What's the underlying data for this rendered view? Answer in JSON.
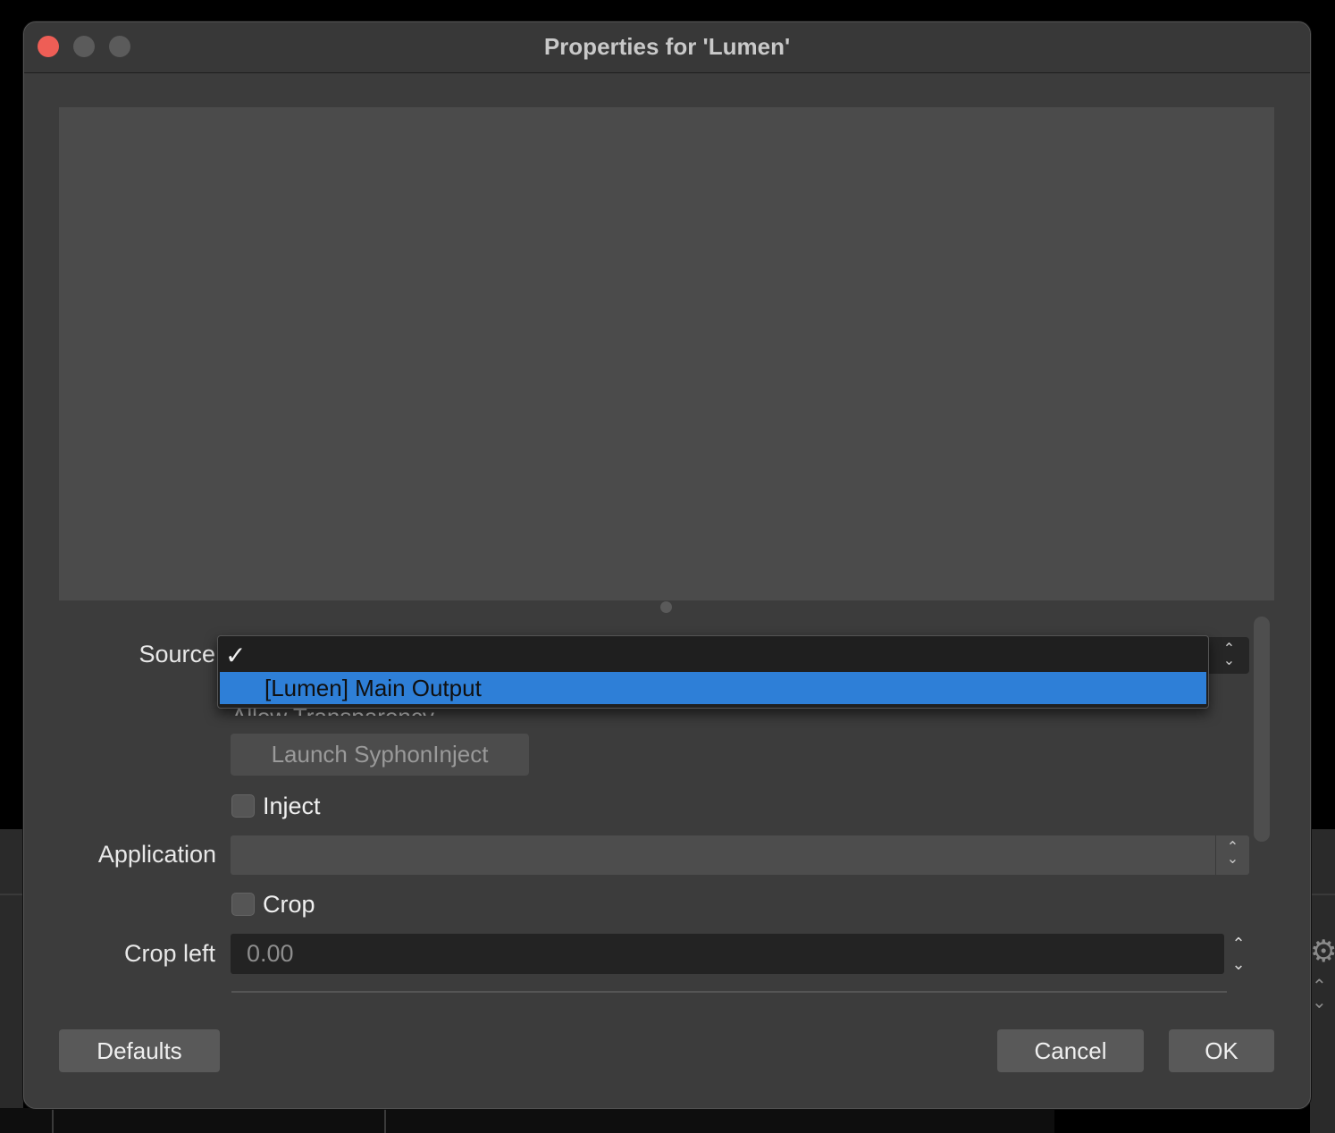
{
  "window": {
    "title": "Properties for 'Lumen'"
  },
  "form": {
    "source": {
      "label": "Source",
      "dropdown": {
        "check_glyph": "✓",
        "options": [
          "[Lumen] Main Output"
        ],
        "highlighted": "[Lumen] Main Output"
      }
    },
    "allow_transparency": {
      "label": "Allow Transparency"
    },
    "launch_button": {
      "label": "Launch SyphonInject"
    },
    "inject": {
      "label": "Inject",
      "checked": false
    },
    "application": {
      "label": "Application",
      "value": ""
    },
    "crop": {
      "label": "Crop",
      "checked": false
    },
    "crop_left": {
      "label": "Crop left",
      "value": "0.00"
    }
  },
  "footer": {
    "defaults_label": "Defaults",
    "cancel_label": "Cancel",
    "ok_label": "OK"
  },
  "icons": {
    "updown": "⌃⌄",
    "spin_up": "⌃",
    "spin_down": "⌄",
    "gear": "⚙"
  },
  "colors": {
    "highlight": "#2e7fd7",
    "close_button": "#ee5e56",
    "window_bg": "#3c3c3c"
  }
}
